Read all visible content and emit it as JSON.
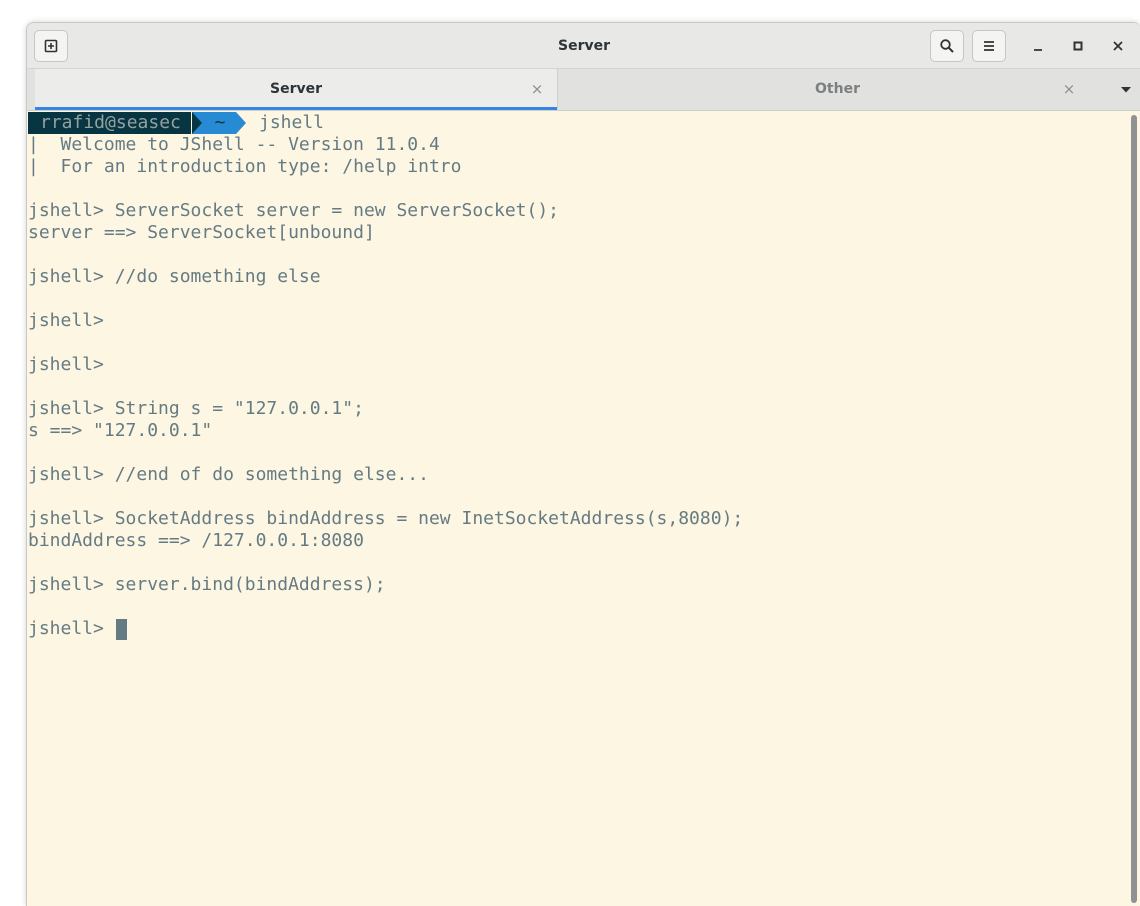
{
  "window": {
    "title": "Server",
    "buttons": {
      "new_tab": "new-tab-icon",
      "search": "search-icon",
      "menu": "hamburger-menu-icon",
      "minimize": "minimize-icon",
      "maximize": "maximize-icon",
      "close": "close-icon"
    }
  },
  "tabs": [
    {
      "label": "Server",
      "active": true,
      "close": "×"
    },
    {
      "label": "Other",
      "active": false,
      "close": "×"
    }
  ],
  "terminal": {
    "prompt": {
      "user": "rrafid@seasec",
      "dir": "~",
      "command": "jshell"
    },
    "lines": [
      "|  Welcome to JShell -- Version 11.0.4",
      "|  For an introduction type: /help intro",
      "",
      "jshell> ServerSocket server = new ServerSocket();",
      "server ==> ServerSocket[unbound]",
      "",
      "jshell> //do something else",
      "",
      "jshell>",
      "",
      "jshell>",
      "",
      "jshell> String s = \"127.0.0.1\";",
      "s ==> \"127.0.0.1\"",
      "",
      "jshell> //end of do something else...",
      "",
      "jshell> SocketAddress bindAddress = new InetSocketAddress(s,8080);",
      "bindAddress ==> /127.0.0.1:8080",
      "",
      "jshell> server.bind(bindAddress);",
      "",
      "jshell> "
    ]
  },
  "colors": {
    "background": "#fdf6e3",
    "foreground": "#657b83",
    "prompt_user_bg": "#073642",
    "prompt_dir_bg": "#268bd2",
    "tab_accent": "#3584e4"
  }
}
